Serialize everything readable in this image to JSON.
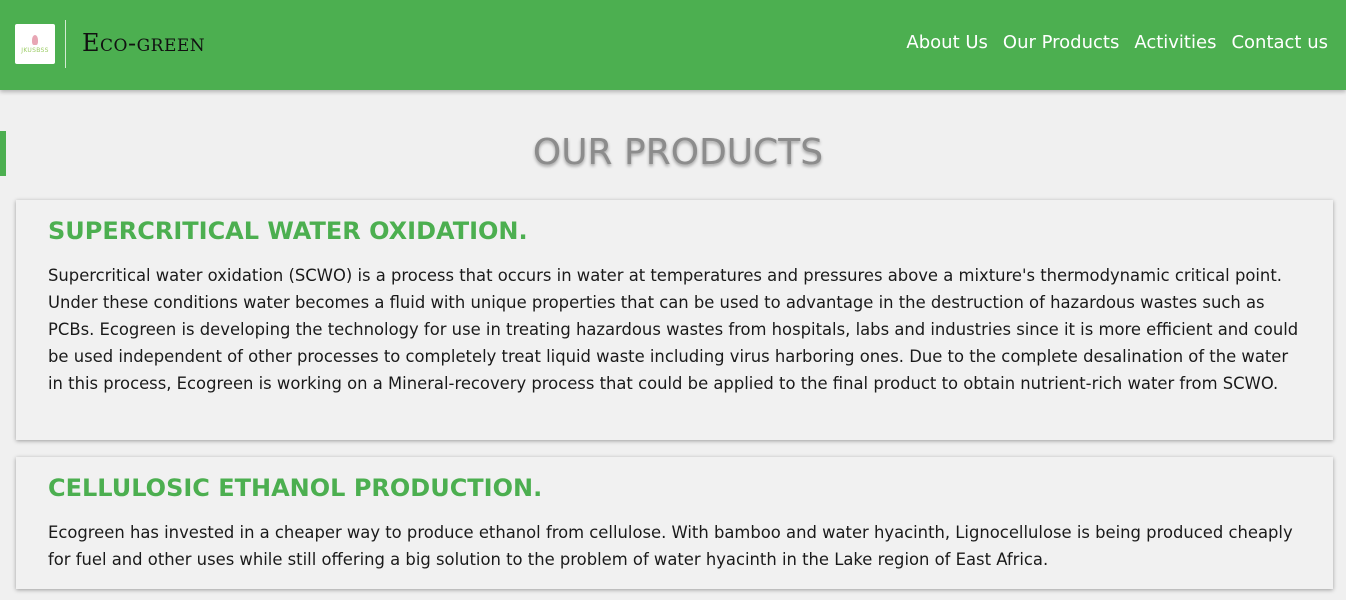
{
  "header": {
    "logo_text": "JKUSBSS",
    "brand": "Eco-green",
    "nav": [
      {
        "label": "About Us"
      },
      {
        "label": "Our Products"
      },
      {
        "label": "Activities"
      },
      {
        "label": "Contact us"
      }
    ]
  },
  "main": {
    "title": "OUR PRODUCTS",
    "products": [
      {
        "title": "SUPERCRITICAL WATER OXIDATION.",
        "description": "Supercritical water oxidation (SCWO) is a process that occurs in water at temperatures and pressures above a mixture's thermodynamic critical point. Under these conditions water becomes a fluid with unique properties that can be used to advantage in the destruction of hazardous wastes such as PCBs. Ecogreen is developing the technology for use in treating hazardous wastes from hospitals, labs and industries since it is more efficient and could be used independent of other processes to completely treat liquid waste including virus harboring ones. Due to the complete desalination of the water in this process, Ecogreen is working on a Mineral-recovery process that could be applied to the final product to obtain nutrient-rich water from SCWO."
      },
      {
        "title": "CELLULOSIC ETHANOL PRODUCTION.",
        "description": "Ecogreen has invested in a cheaper way to produce ethanol from cellulose. With bamboo and water hyacinth, Lignocellulose is being produced cheaply for fuel and other uses while still offering a big solution to the problem of water hyacinth in the Lake region of East Africa."
      }
    ]
  },
  "colors": {
    "accent": "#4caf50",
    "title_gray": "#8c8c8c",
    "background": "#f0f0f0"
  }
}
